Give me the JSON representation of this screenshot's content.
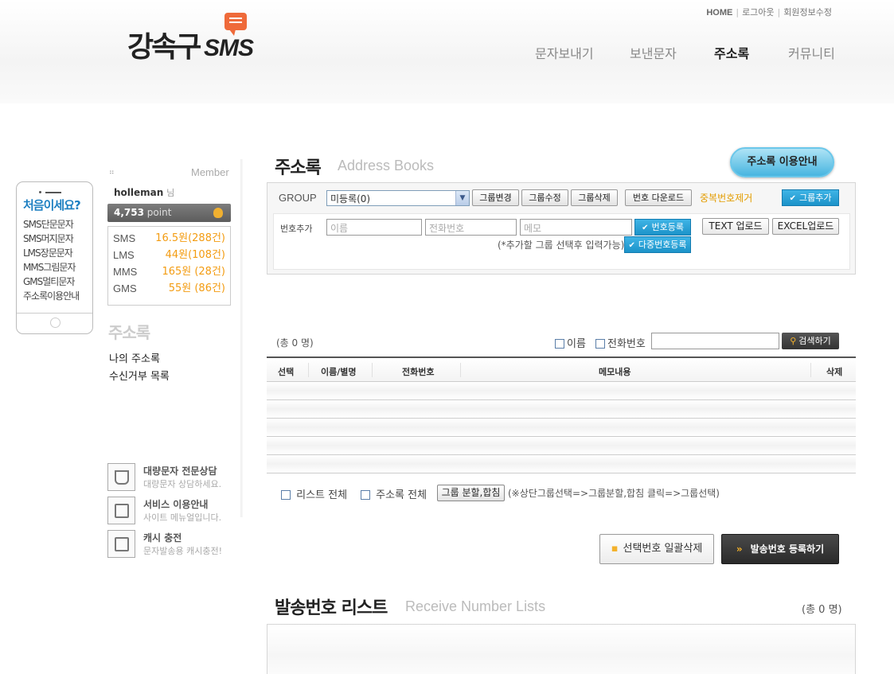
{
  "header": {
    "logo_text_kr": "강속구",
    "logo_text_en": "SMS",
    "util_links": [
      "HOME",
      "로그아웃",
      "회원정보수정"
    ],
    "nav": [
      "문자보내기",
      "보낸문자",
      "주소록",
      "커뮤니티"
    ],
    "nav_active": "주소록"
  },
  "phone_banner": {
    "title": "처음이세요?",
    "items": [
      "SMS단문문자",
      "SMS머지문자",
      "LMS장문문자",
      "MMS그림문자",
      "GMS멀티문자",
      "주소록이용안내"
    ]
  },
  "member": {
    "label": "Member",
    "username": "holleman",
    "suffix": "님",
    "points": "4,753",
    "points_unit": "point",
    "prices": [
      {
        "name": "SMS",
        "value": "16.5원(288건)"
      },
      {
        "name": "LMS",
        "value": "44원(108건)"
      },
      {
        "name": "MMS",
        "value": "165원 (28건)"
      },
      {
        "name": "GMS",
        "value": "55원 (86건)"
      }
    ]
  },
  "side_menu": {
    "title": "주소록",
    "links": [
      "나의 주소록",
      "수신거부 목록"
    ]
  },
  "promos": [
    {
      "title": "대량문자 전문상담",
      "sub": "대량문자 상담하세요."
    },
    {
      "title": "서비스 이용안내",
      "sub": "사이트 메뉴얼입니다."
    },
    {
      "title": "캐시 충전",
      "sub": "문자발송용 캐시충전!"
    }
  ],
  "main": {
    "title": "주소록",
    "subtitle": "Address Books",
    "guide_button": "주소록 이용안내",
    "group_label": "GROUP",
    "group_selected": "미등록(0)",
    "group_buttons": [
      "그룹변경",
      "그룹수정",
      "그룹삭제",
      "번호 다운로드"
    ],
    "dup_remove": "중복번호제거",
    "group_add": "그룹추가",
    "add_label": "번호추가",
    "placeholders": {
      "name": "이름",
      "phone": "전화번호",
      "memo": "메모"
    },
    "register_button": "번호등록",
    "text_upload": "TEXT 업로드",
    "excel_upload": "EXCEL업로드",
    "hint": "(*추가할 그룹 선택후 입력가능)",
    "multi_register": "다중번호등록",
    "count": "(총 0 명)",
    "search_name": "이름",
    "search_phone": "전화번호",
    "search_button": "검색하기",
    "columns": [
      "선택",
      "이름/별명",
      "전화번호",
      "메모내용",
      "삭제"
    ],
    "rows": [
      "",
      "",
      "",
      "",
      ""
    ],
    "check_list_all": "리스트 전체",
    "check_book_all": "주소록 전체",
    "split_button": "그룹 분할,합침",
    "split_note": "(※상단그룹선택=>그룹분할,합침 클릭=>그룹선택)",
    "bulk_delete": "선택번호 일괄삭제",
    "register_sender": "발송번호 등록하기"
  },
  "sender_list": {
    "title": "발송번호 리스트",
    "subtitle": "Receive Number Lists",
    "count": "(총 0 명)"
  },
  "colors": {
    "accent_blue": "#1d93c9",
    "accent_orange": "#f39c12",
    "brand_red": "#ef6a3a"
  }
}
